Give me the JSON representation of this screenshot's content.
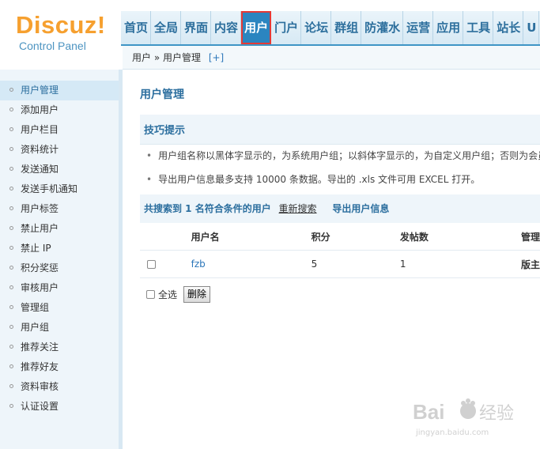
{
  "logo": {
    "name": "Discuz!",
    "subtitle": "Control Panel"
  },
  "topnav": {
    "items": [
      "首页",
      "全局",
      "界面",
      "内容",
      "用户",
      "门户",
      "论坛",
      "群组",
      "防灌水",
      "运营",
      "应用",
      "工具",
      "站长",
      "U"
    ],
    "active_index": 4
  },
  "breadcrumb": {
    "path": "用户 » 用户管理",
    "add": "[+]"
  },
  "sidebar": {
    "items": [
      "用户管理",
      "添加用户",
      "用户栏目",
      "资料统计",
      "发送通知",
      "发送手机通知",
      "用户标签",
      "禁止用户",
      "禁止 IP",
      "积分奖惩",
      "审核用户",
      "管理组",
      "用户组",
      "推荐关注",
      "推荐好友",
      "资料审核",
      "认证设置"
    ],
    "active_index": 0
  },
  "main": {
    "title": "用户管理",
    "tips": {
      "heading": "技巧提示",
      "items": [
        "用户组名称以黑体字显示的，为系统用户组；以斜体字显示的，为自定义用户组；否则为会员",
        "导出用户信息最多支持 10000 条数据。导出的 .xls 文件可用 EXCEL 打开。"
      ]
    },
    "result": {
      "summary": "共搜索到 1 名符合条件的用户",
      "research": "重新搜索",
      "export": "导出用户信息"
    },
    "table": {
      "headers": [
        "",
        "用户名",
        "积分",
        "发帖数",
        "管理"
      ],
      "rows": [
        {
          "username": "fzb",
          "credits": "5",
          "posts": "1",
          "role": "版主"
        }
      ]
    },
    "actions": {
      "select_all": "全选",
      "delete": "删除"
    }
  },
  "watermark": {
    "brand": "Bai",
    "brand_cn": "经验",
    "url": "jingyan.baidu.com"
  },
  "colors": {
    "accent": "#2b85c0",
    "logo": "#f6a02f",
    "highlight_box": "#e53935"
  }
}
